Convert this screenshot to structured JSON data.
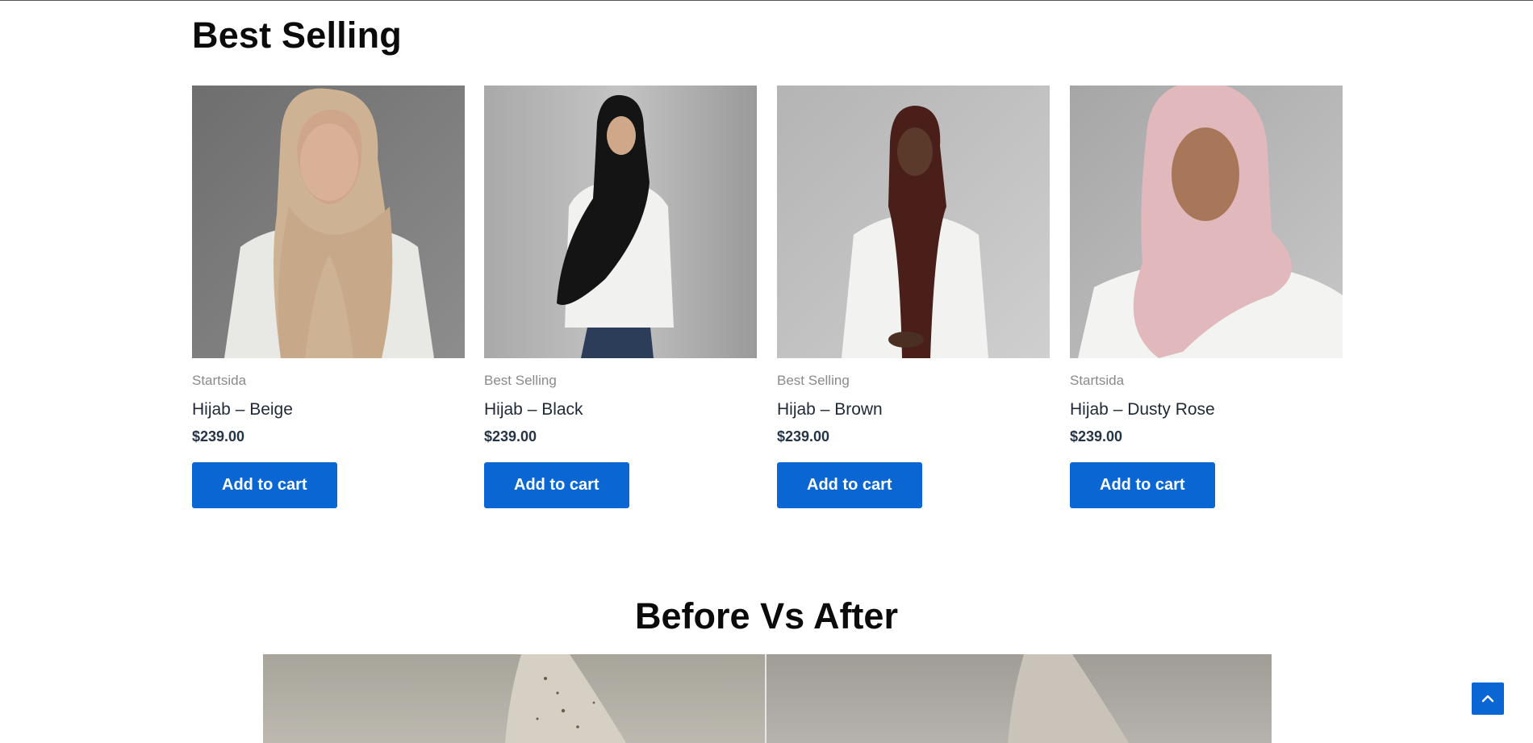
{
  "section_title": "Best Selling",
  "products": [
    {
      "category": "Startsida",
      "title": "Hijab – Beige",
      "price": "$239.00",
      "button": "Add to cart",
      "image_icon": "product-photo-beige-hijab"
    },
    {
      "category": "Best Selling",
      "title": "Hijab – Black",
      "price": "$239.00",
      "button": "Add to cart",
      "image_icon": "product-photo-black-hijab"
    },
    {
      "category": "Best Selling",
      "title": "Hijab – Brown",
      "price": "$239.00",
      "button": "Add to cart",
      "image_icon": "product-photo-brown-hijab"
    },
    {
      "category": "Startsida",
      "title": "Hijab – Dusty Rose",
      "price": "$239.00",
      "button": "Add to cart",
      "image_icon": "product-photo-dusty-rose-hijab"
    }
  ],
  "before_after": {
    "title": "Before Vs After"
  },
  "colors": {
    "accent": "#0a66d2",
    "price": "#263447",
    "category": "#8a8a8a"
  },
  "scroll_top": {
    "icon": "chevron-up-icon"
  }
}
